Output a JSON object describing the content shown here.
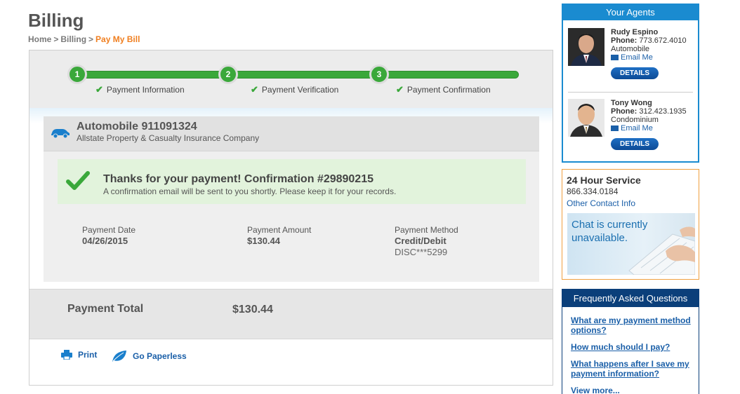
{
  "page": {
    "title": "Billing",
    "breadcrumb": {
      "home": "Home",
      "sep1": ">",
      "billing": "Billing",
      "sep2": ">",
      "current": "Pay My Bill"
    }
  },
  "progress": {
    "steps": [
      {
        "number": "1",
        "label": "Payment Information"
      },
      {
        "number": "2",
        "label": "Payment Verification"
      },
      {
        "number": "3",
        "label": "Payment Confirmation"
      }
    ]
  },
  "policy": {
    "title": "Automobile 911091324",
    "company": "Allstate Property & Casualty Insurance Company"
  },
  "confirmation": {
    "title": "Thanks for your payment! Confirmation #29890215",
    "subtitle": "A confirmation email will be sent to you shortly. Please keep it for your records."
  },
  "details": {
    "date_label": "Payment Date",
    "date_value": "04/26/2015",
    "amount_label": "Payment Amount",
    "amount_value": "$130.44",
    "method_label": "Payment Method",
    "method_value": "Credit/Debit",
    "method_card": "DISC***5299"
  },
  "total": {
    "label": "Payment Total",
    "value": "$130.44"
  },
  "footer": {
    "print_label": "Print",
    "paperless_label": "Go Paperless"
  },
  "agents": {
    "header": "Your Agents",
    "list": [
      {
        "name": "Rudy Espino",
        "phone_label": "Phone:",
        "phone": "773.672.4010",
        "type": "Automobile",
        "email_label": "Email Me",
        "details_label": "DETAILS"
      },
      {
        "name": "Tony Wong",
        "phone_label": "Phone:",
        "phone": "312.423.1935",
        "type": "Condominium",
        "email_label": "Email Me",
        "details_label": "DETAILS"
      }
    ]
  },
  "service": {
    "title": "24 Hour Service",
    "phone": "866.334.0184",
    "link": "Other Contact Info",
    "chat_status": "Chat is currently unavailable."
  },
  "faq": {
    "header": "Frequently Asked Questions",
    "items": [
      "What are my payment method options?",
      "How much should I pay?",
      "What happens after I save my payment information?",
      "View more..."
    ]
  },
  "colors": {
    "accent_green": "#3aa83a",
    "link_blue": "#1a5fa8",
    "breadcrumb_orange": "#f07f20",
    "agent_blue": "#1a8bd0",
    "faq_navy": "#0b3f7a"
  }
}
